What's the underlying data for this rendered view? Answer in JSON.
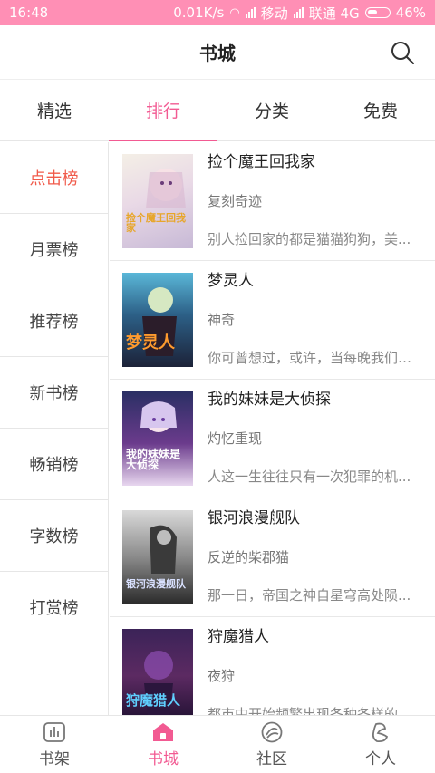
{
  "status_bar": {
    "time": "16:48",
    "speed": "0.01K/s",
    "carrier1": "移动",
    "carrier2": "联通 4G",
    "battery": "46%"
  },
  "header": {
    "title": "书城",
    "search_icon": "search-icon"
  },
  "tabs": [
    {
      "label": "精选"
    },
    {
      "label": "排行",
      "active": true
    },
    {
      "label": "分类"
    },
    {
      "label": "免费"
    }
  ],
  "sidebar": {
    "items": [
      {
        "label": "点击榜",
        "active": true
      },
      {
        "label": "月票榜"
      },
      {
        "label": "推荐榜"
      },
      {
        "label": "新书榜"
      },
      {
        "label": "畅销榜"
      },
      {
        "label": "字数榜"
      },
      {
        "label": "打赏榜"
      }
    ]
  },
  "books": [
    {
      "title": "捡个魔王回我家",
      "author": "复刻奇迹",
      "desc": "别人捡回家的都是猫猫狗狗，美...",
      "cover_text": "捡个魔王回我家"
    },
    {
      "title": "梦灵人",
      "author": "神奇",
      "desc": "你可曾想过，或许，当每晚我们闭...",
      "cover_text": "梦灵人"
    },
    {
      "title": "我的妹妹是大侦探",
      "author": "灼忆重现",
      "desc": "人这一生往往只有一次犯罪的机...",
      "cover_text": "我的妹妹是大侦探"
    },
    {
      "title": "银河浪漫舰队",
      "author": "反逆的柴郡猫",
      "desc": "那一日，帝国之神自星穹高处陨...",
      "cover_text": "银河浪漫舰队"
    },
    {
      "title": "狩魔猎人",
      "author": "夜狩",
      "desc": "都市中开始频繁出现各种各样的...",
      "cover_text": "狩魔猎人"
    }
  ],
  "colors": {
    "accent": "#f25a92",
    "status_bar": "#ff8fb5",
    "sidebar_active": "#f05a4a"
  },
  "bottom_nav": [
    {
      "label": "书架",
      "icon": "bookshelf-icon"
    },
    {
      "label": "书城",
      "icon": "bookstore-icon",
      "active": true
    },
    {
      "label": "社区",
      "icon": "community-icon"
    },
    {
      "label": "个人",
      "icon": "profile-icon"
    }
  ]
}
